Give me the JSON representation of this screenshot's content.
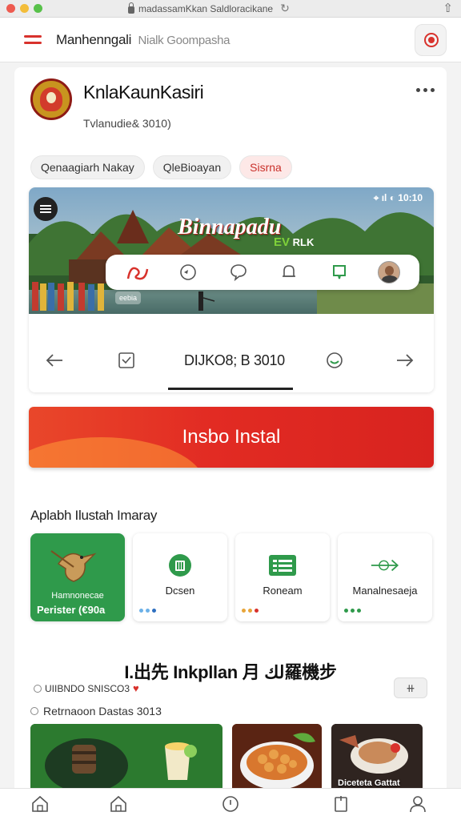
{
  "browser": {
    "url": "madassamKkan Saldloracikane"
  },
  "header": {
    "title": "Manhenngali",
    "subtitle": "Nialk Goompasha"
  },
  "profile": {
    "name": "KnlaKaunKasiri",
    "meta": "Tvlanudie& 3010)"
  },
  "chips": [
    {
      "label": "Qenaagiarh Nakay"
    },
    {
      "label": "QleBioayan"
    },
    {
      "label": "Sisrna"
    }
  ],
  "hero": {
    "title": "Binnapadu",
    "tag_prefix": "EV",
    "tag_text": "RLK",
    "status": "⌖ ıl ◐ 10:10",
    "badge": "eebia",
    "date": "DIJKO8; B 3010"
  },
  "cta": {
    "label": "Insbo Instal"
  },
  "section": {
    "title": "Aplabh Ilustah Imaray"
  },
  "tiles": [
    {
      "label": "Hamnonecae",
      "price": "Perister (€90a"
    },
    {
      "label": "Dcsen"
    },
    {
      "label": "Roneam"
    },
    {
      "label": "Manalnesaeja"
    }
  ],
  "headline": "I.出先 Inkpllan 月 لك羅機步",
  "meta_line_1": "UIIBNDO SNISCO3",
  "meta_line_2": "Retrnaoon Dastas 3013",
  "photos": {
    "caption": "Diceteta Gattat"
  },
  "colors": {
    "accent": "#d8322c",
    "green": "#2f9a4b"
  }
}
